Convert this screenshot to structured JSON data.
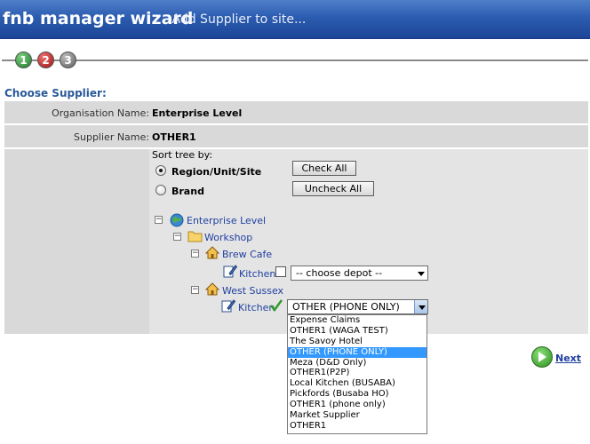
{
  "titlebar": {
    "title": "fnb manager wizard",
    "subtitle": "- Add Supplier to site..."
  },
  "steps": [
    {
      "label": "1"
    },
    {
      "label": "2"
    },
    {
      "label": "3"
    }
  ],
  "section_title": "Choose Supplier:",
  "organisation": {
    "label": "Organisation Name:",
    "value": "Enterprise Level"
  },
  "supplier": {
    "label": "Supplier Name:",
    "value": "OTHER1"
  },
  "sort": {
    "label": "Sort tree by:",
    "options": [
      {
        "label": "Region/Unit/Site",
        "selected": true
      },
      {
        "label": "Brand",
        "selected": false
      }
    ],
    "check_all": "Check All",
    "uncheck_all": "Uncheck All"
  },
  "tree": {
    "root": "Enterprise Level",
    "workshop": "Workshop",
    "brew_cafe": "Brew Cafe",
    "kitchen_1": "Kitchen",
    "depot_placeholder": "-- choose depot --",
    "west_sussex": "West Sussex",
    "kitchen_2": "Kitchen",
    "selected_depot": "OTHER (PHONE ONLY)"
  },
  "dropdown_options": [
    "Expense Claims",
    "OTHER1 (WAGA TEST)",
    "The Savoy Hotel",
    "OTHER (PHONE ONLY)",
    "Meza (D&D Only)",
    "OTHER1(P2P)",
    "Local Kitchen (BUSABA)",
    "Pickfords (Busaba HO)",
    "OTHER1 (phone only)",
    "Market Supplier",
    "OTHER1"
  ],
  "selected_option_index": 3,
  "next_label": "Next",
  "colors": {
    "title_bg": "#2c5cb0",
    "section_title": "#2a5a9a",
    "panel_bg": "#d9d9d9",
    "selection": "#3399ff"
  },
  "icons": {
    "globe": "globe-icon",
    "folder": "folder-icon",
    "home": "home-icon",
    "edit": "edit-icon",
    "check": "check-icon",
    "next": "next-arrow-icon"
  }
}
